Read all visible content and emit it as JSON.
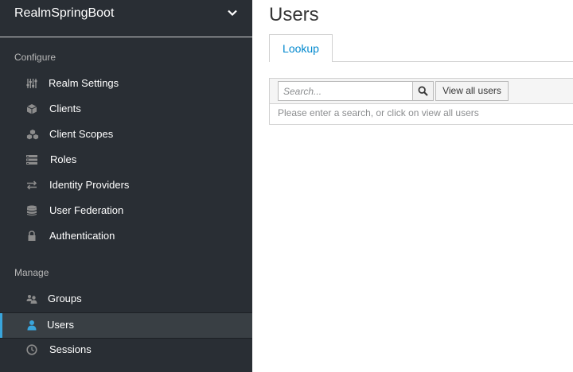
{
  "realm": {
    "name": "RealmSpringBoot",
    "chevron_icon": "chevron-down-icon"
  },
  "sidebar": {
    "configure_title": "Configure",
    "configure_items": [
      {
        "label": "Realm Settings",
        "icon": "sliders-icon"
      },
      {
        "label": "Clients",
        "icon": "cube-icon"
      },
      {
        "label": "Client Scopes",
        "icon": "cubes-icon"
      },
      {
        "label": "Roles",
        "icon": "list-icon"
      },
      {
        "label": "Identity Providers",
        "icon": "exchange-icon"
      },
      {
        "label": "User Federation",
        "icon": "database-icon"
      },
      {
        "label": "Authentication",
        "icon": "lock-icon"
      }
    ],
    "manage_title": "Manage",
    "manage_items": [
      {
        "label": "Groups",
        "icon": "users-icon"
      },
      {
        "label": "Users",
        "icon": "user-icon",
        "active": true
      },
      {
        "label": "Sessions",
        "icon": "clock-icon"
      }
    ]
  },
  "main": {
    "title": "Users",
    "tabs": [
      {
        "label": "Lookup",
        "active": true
      }
    ],
    "search": {
      "placeholder": "Search...",
      "value": ""
    },
    "view_all_label": "View all users",
    "empty_message": "Please enter a search, or click on view all users"
  },
  "colors": {
    "sidebar_bg": "#292e34",
    "active_item_bg": "#393f44",
    "accent": "#39a5dc",
    "link": "#0088ce"
  }
}
